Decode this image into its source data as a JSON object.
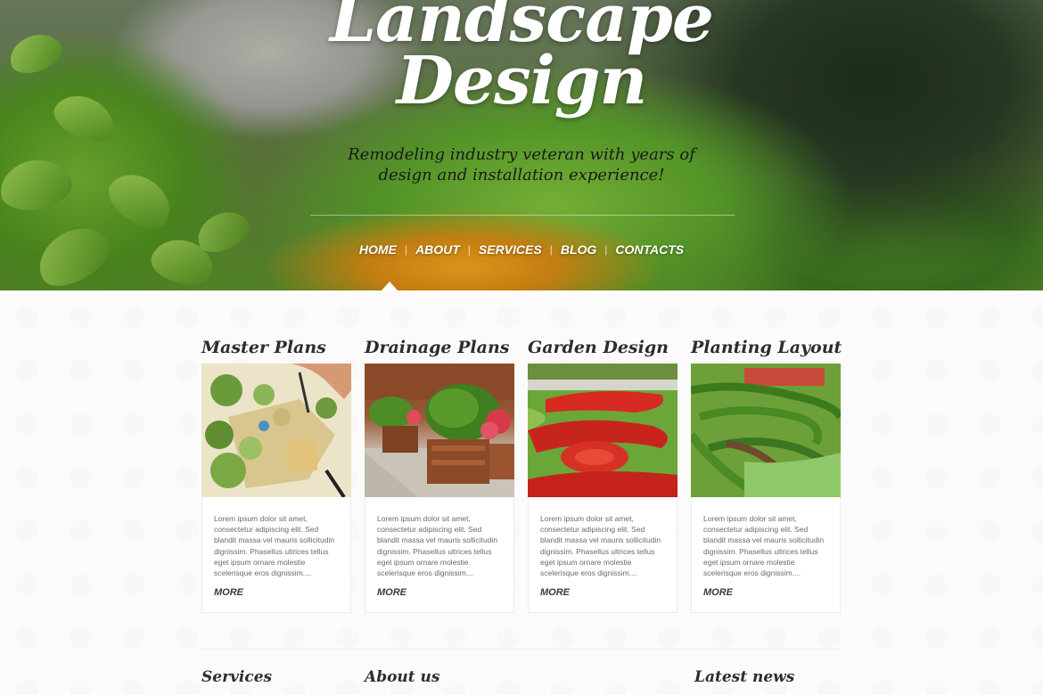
{
  "hero": {
    "title_line1": "Landscape",
    "title_line2": "Design",
    "subtitle_line1": "Remodeling industry veteran with years of",
    "subtitle_line2": "design and installation experience!"
  },
  "nav": {
    "items": [
      {
        "label": "HOME"
      },
      {
        "label": "ABOUT"
      },
      {
        "label": "SERVICES"
      },
      {
        "label": "BLOG"
      },
      {
        "label": "CONTACTS"
      }
    ],
    "separator": "|"
  },
  "cards": [
    {
      "title": "Master Plans",
      "image": "master-plan-drawing-image",
      "text": "Lorem ipsum dolor sit amet, consectetur adipiscing elit. Sed blandit massa vel mauris sollicitudin dignissim. Phasellus ultrices tellus eget ipsum ornare molestie scelerisque eros dignissim....",
      "more": "MORE"
    },
    {
      "title": "Drainage Plans",
      "image": "planter-boxes-image",
      "text": "Lorem ipsum dolor sit amet, consectetur adipiscing elit. Sed blandit massa vel mauris sollicitudin dignissim. Phasellus ultrices tellus eget ipsum ornare molestie scelerisque eros dignissim....",
      "more": "MORE"
    },
    {
      "title": "Garden Design",
      "image": "flower-garden-image",
      "text": "Lorem ipsum dolor sit amet, consectetur adipiscing elit. Sed blandit massa vel mauris sollicitudin dignissim. Phasellus ultrices tellus eget ipsum ornare molestie scelerisque eros dignissim....",
      "more": "MORE"
    },
    {
      "title": "Planting Layout",
      "image": "hedge-maze-image",
      "text": "Lorem ipsum dolor sit amet, consectetur adipiscing elit. Sed blandit massa vel mauris sollicitudin dignissim. Phasellus ultrices tellus eget ipsum ornare molestie scelerisque eros dignissim....",
      "more": "MORE"
    }
  ],
  "footer": {
    "services": "Services",
    "about": "About us",
    "news": "Latest news"
  }
}
